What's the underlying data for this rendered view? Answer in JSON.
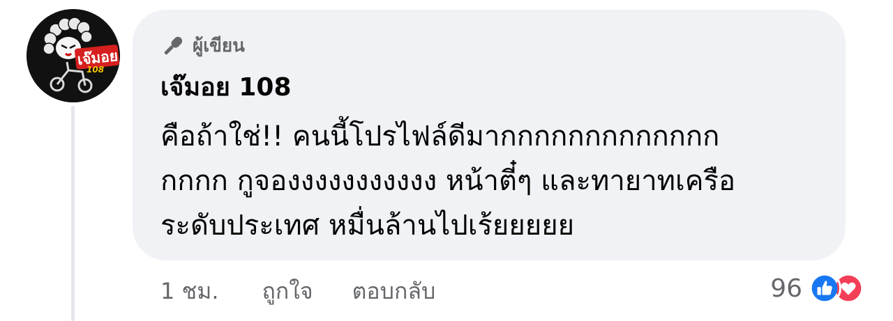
{
  "comment": {
    "avatar_icon": "avatar-icon",
    "avatar_text": "เจ๊มอย",
    "avatar_number": "108",
    "badge": {
      "icon": "microphone-icon",
      "label": "ผู้เขียน"
    },
    "author": "เจ๊มอย 108",
    "text_lines": [
      "คือถ้าใช่!! คนนี้โปรไฟล์ดีมากกกกกกกกกกกกก",
      "กกกก กูจองงงงงงงงงงง หน้าตี๋ๆ และทายาทเครือ",
      "ระดับประเทศ หมื่นล้านไปเร้ยยยยย"
    ],
    "time": "1 ชม.",
    "like_label": "ถูกใจ",
    "reply_label": "ตอบกลับ",
    "reaction_count": "96",
    "reactions": [
      "like-icon",
      "love-icon"
    ]
  },
  "colors": {
    "bubble": "#f0f2f5",
    "text": "#050505",
    "secondary": "#65676b",
    "like": "#1877f2",
    "love": "#f33e58"
  }
}
